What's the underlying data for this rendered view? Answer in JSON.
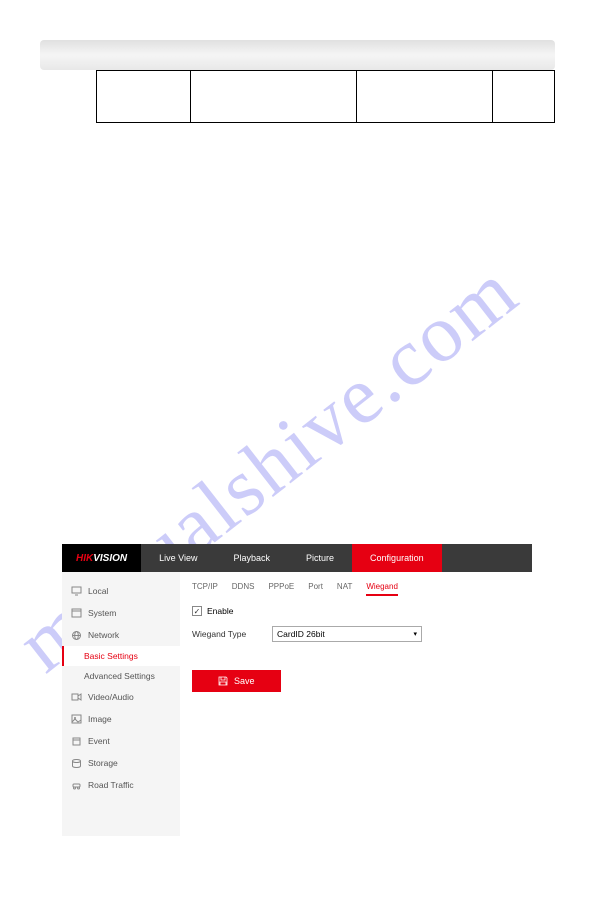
{
  "watermark": "manualshive.com",
  "logo": {
    "prefix": "HIK",
    "suffix": "VISION"
  },
  "topnav": [
    {
      "label": "Live View",
      "active": false
    },
    {
      "label": "Playback",
      "active": false
    },
    {
      "label": "Picture",
      "active": false
    },
    {
      "label": "Configuration",
      "active": true
    }
  ],
  "sidebar": {
    "items": [
      {
        "label": "Local",
        "icon": "monitor-icon"
      },
      {
        "label": "System",
        "icon": "window-icon"
      },
      {
        "label": "Network",
        "icon": "globe-icon",
        "expanded": true,
        "sub": [
          {
            "label": "Basic Settings",
            "active": true
          },
          {
            "label": "Advanced Settings",
            "active": false
          }
        ]
      },
      {
        "label": "Video/Audio",
        "icon": "video-icon"
      },
      {
        "label": "Image",
        "icon": "image-icon"
      },
      {
        "label": "Event",
        "icon": "event-icon"
      },
      {
        "label": "Storage",
        "icon": "storage-icon"
      },
      {
        "label": "Road Traffic",
        "icon": "traffic-icon"
      }
    ]
  },
  "tabs": [
    {
      "label": "TCP/IP",
      "active": false
    },
    {
      "label": "DDNS",
      "active": false
    },
    {
      "label": "PPPoE",
      "active": false
    },
    {
      "label": "Port",
      "active": false
    },
    {
      "label": "NAT",
      "active": false
    },
    {
      "label": "Wiegand",
      "active": true
    }
  ],
  "form": {
    "enable_label": "Enable",
    "enable_checked": true,
    "type_label": "Wiegand Type",
    "type_value": "CardID 26bit",
    "save_label": "Save"
  }
}
